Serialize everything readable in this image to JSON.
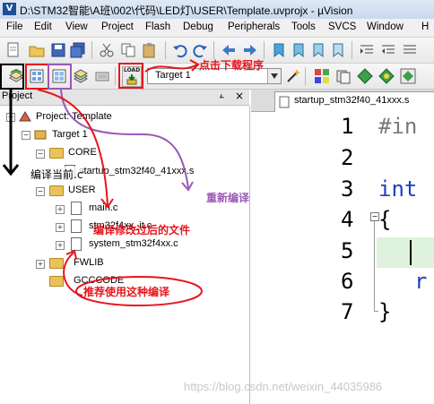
{
  "window": {
    "title": "D:\\STM32智能\\A班\\002\\代码\\LED灯\\USER\\Template.uvprojx - µVision",
    "icon_text": "V"
  },
  "menu": [
    "File",
    "Edit",
    "View",
    "Project",
    "Flash",
    "Debug",
    "Peripherals",
    "Tools",
    "SVCS",
    "Window",
    "H"
  ],
  "toolbar2": {
    "target_select": "Target 1",
    "load_label": "LOAD"
  },
  "project_panel": {
    "title": "Project",
    "pin": "പ",
    "close": "×"
  },
  "tree": {
    "project": "Project: Template",
    "target": "Target 1",
    "core": "CORE",
    "startup": "startup_stm32f40_41xxx.s",
    "user": "USER",
    "main": "main.c",
    "it": "stm32f4xx_it.c",
    "system": "system_stm32f4xx.c",
    "fwlib": "FWLIB",
    "gcccode": "GCCCODE"
  },
  "editor": {
    "tab": "startup_stm32f40_41xxx.s",
    "lines": [
      {
        "no": "1",
        "text": "#in"
      },
      {
        "no": "2",
        "text": ""
      },
      {
        "no": "3",
        "text": "int"
      },
      {
        "no": "4",
        "text": "{"
      },
      {
        "no": "5",
        "text": ""
      },
      {
        "no": "6",
        "text": "r"
      },
      {
        "no": "7",
        "text": "}"
      }
    ]
  },
  "annotations": {
    "download": "点击下载程序",
    "compile_current": "编译当前.c",
    "rebuild": "重新编译",
    "compile_modified": "编译修改过后的文件",
    "recommended": "推荐使用这种编译"
  },
  "watermark": "https://blog.csdn.net/weixin_44035986",
  "colors": {
    "annotation_red": "#e8141c",
    "annotation_purple": "#9b59b6",
    "keyword_blue": "#1f3fbf",
    "preprocessor_gray": "#7a7a7a"
  }
}
